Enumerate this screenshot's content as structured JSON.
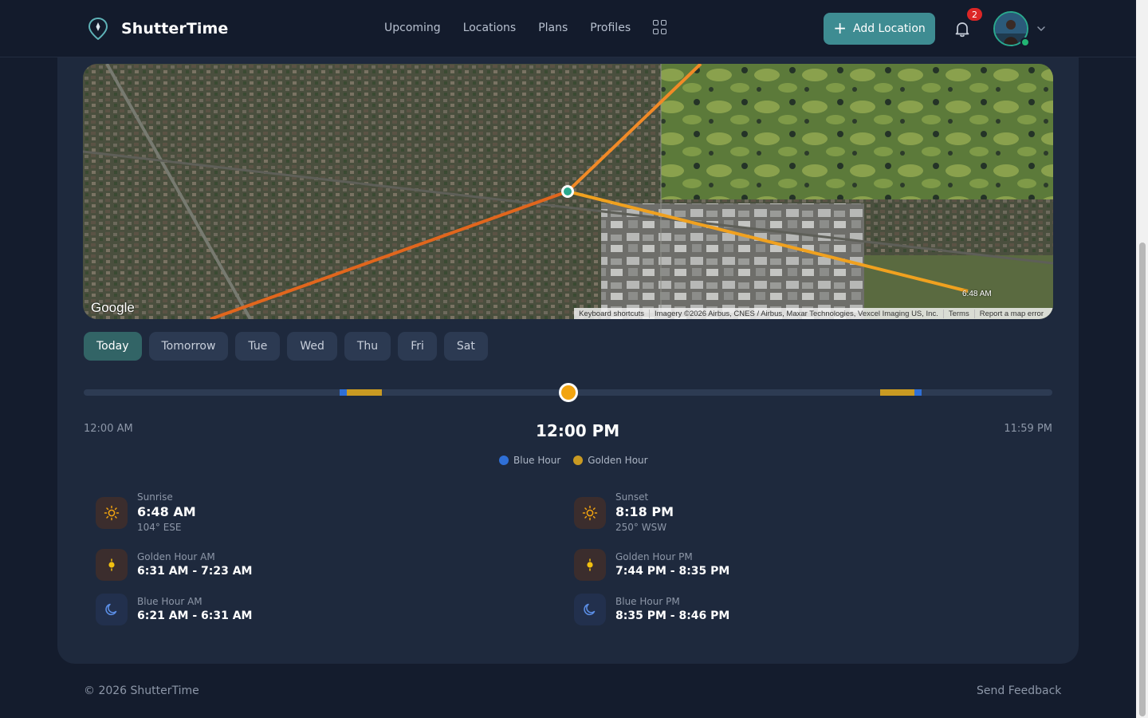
{
  "brand": {
    "name": "ShutterTime",
    "logo_icon": "map-pin-icon"
  },
  "nav": {
    "links": [
      "Upcoming",
      "Locations",
      "Plans",
      "Profiles"
    ],
    "apps_icon": "grid-icon"
  },
  "header": {
    "add_location_label": "Add Location",
    "notifications_count": "2",
    "bell_icon": "bell-icon"
  },
  "map": {
    "google_label": "Google",
    "sunrise_marker": "6:48 AM",
    "footer": {
      "shortcuts": "Keyboard shortcuts",
      "imagery": "Imagery ©2026 Airbus, CNES / Airbus, Maxar Technologies, Vexcel Imaging US, Inc.",
      "terms": "Terms",
      "report": "Report a map error"
    }
  },
  "tabs": [
    "Today",
    "Tomorrow",
    "Tue",
    "Wed",
    "Thu",
    "Fri",
    "Sat"
  ],
  "active_tab": "Today",
  "timeline": {
    "start_label": "12:00 AM",
    "current_label": "12:00 PM",
    "end_label": "11:59 PM",
    "current_fraction": 0.5,
    "segments": [
      {
        "kind": "blue",
        "start": "6:21 AM",
        "end": "6:31 AM"
      },
      {
        "kind": "golden",
        "start": "6:31 AM",
        "end": "7:23 AM"
      },
      {
        "kind": "golden",
        "start": "7:44 PM",
        "end": "8:35 PM"
      },
      {
        "kind": "blue",
        "start": "8:35 PM",
        "end": "8:46 PM"
      }
    ]
  },
  "legend": {
    "blue": "Blue Hour",
    "golden": "Golden Hour"
  },
  "colors": {
    "blue_hour": "#2f6fd6",
    "golden_hour": "#c99a22",
    "accent": "#3e8c92",
    "thumb": "#f2a410"
  },
  "sun": {
    "sunrise": {
      "label": "Sunrise",
      "time": "6:48 AM",
      "azimuth": "104° ESE",
      "icon": "sun-icon"
    },
    "sunset": {
      "label": "Sunset",
      "time": "8:18 PM",
      "azimuth": "250° WSW",
      "icon": "sun-icon"
    },
    "golden_am": {
      "label": "Golden Hour AM",
      "range": "6:31 AM - 7:23 AM",
      "icon": "golden-hour-icon"
    },
    "golden_pm": {
      "label": "Golden Hour PM",
      "range": "7:44 PM - 8:35 PM",
      "icon": "golden-hour-icon"
    },
    "blue_am": {
      "label": "Blue Hour AM",
      "range": "6:21 AM - 6:31 AM",
      "icon": "moon-icon"
    },
    "blue_pm": {
      "label": "Blue Hour PM",
      "range": "8:35 PM - 8:46 PM",
      "icon": "moon-icon"
    }
  },
  "footer": {
    "copyright": "© 2026 ShutterTime",
    "feedback": "Send Feedback"
  }
}
